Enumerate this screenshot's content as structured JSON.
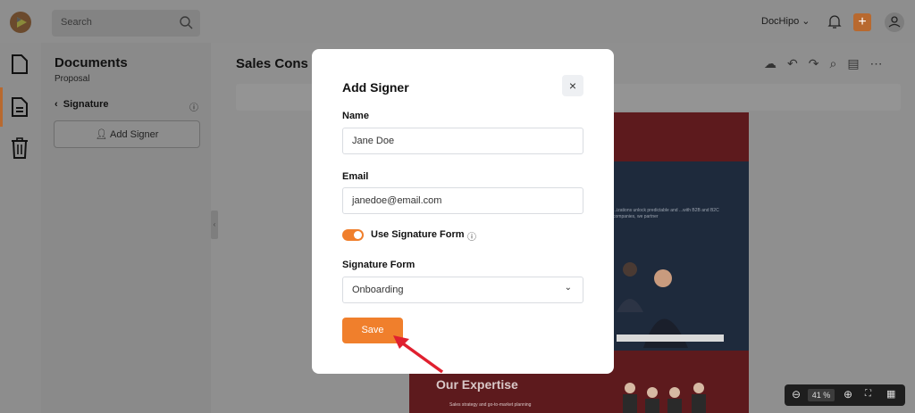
{
  "topbar": {
    "search_placeholder": "Search",
    "workspace_label": "DocHipo",
    "plus_label": "+"
  },
  "panel": {
    "title": "Documents",
    "subtitle": "Proposal",
    "section": "Signature",
    "add_signer_label": "Add Signer"
  },
  "canvas": {
    "doc_title": "Sales Cons",
    "page_text": "...izations unlock predictable and ...with B2B and B2C companies, we partner",
    "expertise_title": "Our Expertise",
    "expertise_line": "Sales strategy and go-to-market planning",
    "zoom_value": "41 %"
  },
  "modal": {
    "title": "Add Signer",
    "close_label": "×",
    "name_label": "Name",
    "name_value": "Jane Doe",
    "email_label": "Email",
    "email_value": "janedoe@email.com",
    "toggle_label": "Use Signature Form",
    "toggle_on": true,
    "form_label": "Signature Form",
    "form_value": "Onboarding",
    "save_label": "Save"
  },
  "colors": {
    "accent": "#f07f2c",
    "overlay": "#8f8f8f",
    "page_red": "#5d1a1d",
    "arrow": "#e0202f"
  },
  "icons": {
    "rail": [
      "document-icon",
      "document-lines-icon",
      "trash-icon"
    ],
    "toolbar": [
      "cloud-icon",
      "undo-icon",
      "redo-icon",
      "search-icon",
      "comment-icon",
      "more-icon"
    ]
  }
}
